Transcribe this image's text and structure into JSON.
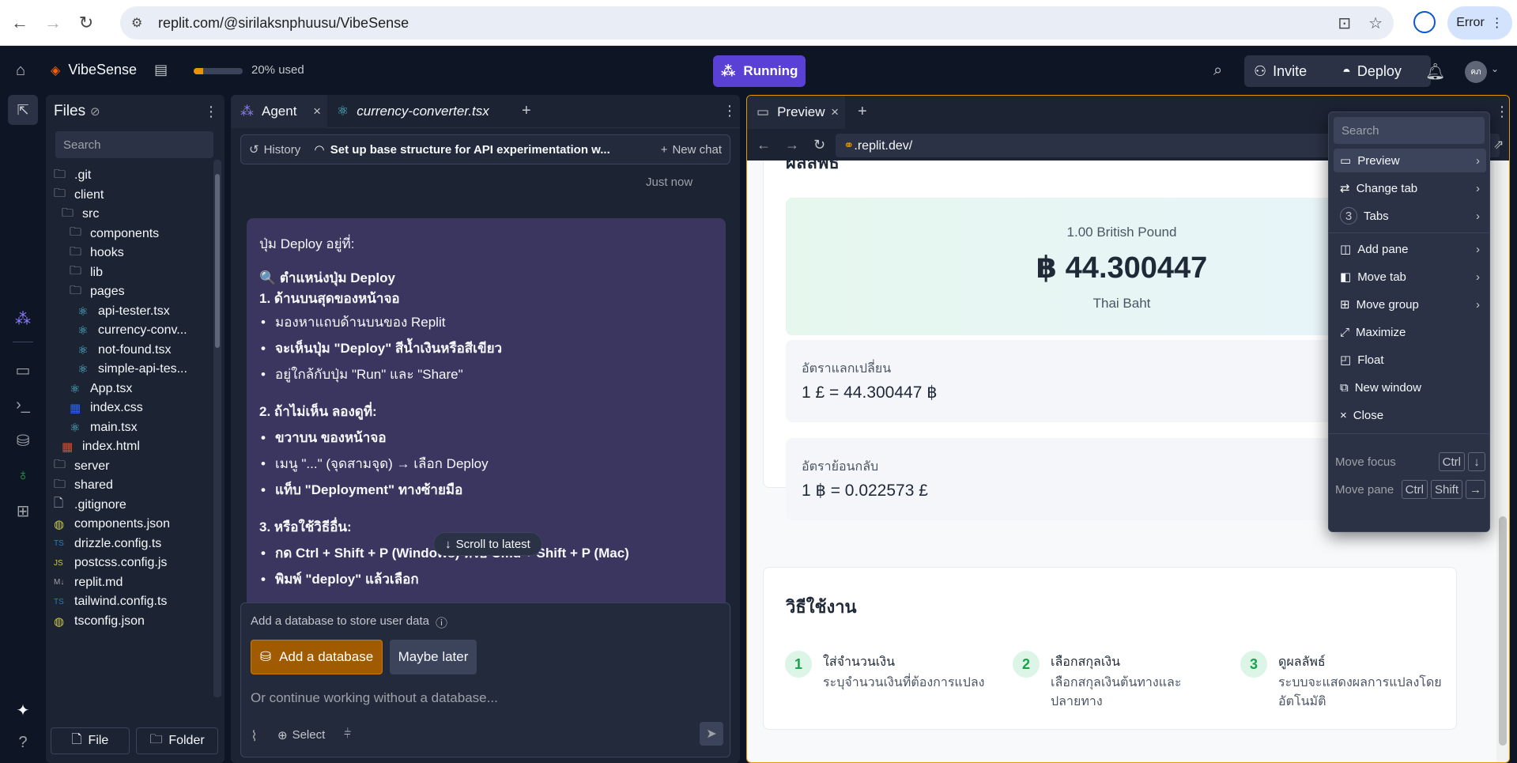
{
  "browser": {
    "url": "replit.com/@sirilaksnphuusu/VibeSense",
    "profile_button": "Error"
  },
  "header": {
    "repl_name": "VibeSense",
    "usage_fraction": 0.2,
    "usage_text": "20% used",
    "run_status": "Running",
    "invite_label": "Invite",
    "deploy_label": "Deploy",
    "avatar_text": "คภ"
  },
  "files": {
    "title": "Files",
    "search_placeholder": "Search",
    "tree": [
      {
        "name": ".git",
        "type": "folder",
        "depth": 0
      },
      {
        "name": "client",
        "type": "folder",
        "depth": 0
      },
      {
        "name": "src",
        "type": "folder",
        "depth": 1
      },
      {
        "name": "components",
        "type": "folder",
        "depth": 2
      },
      {
        "name": "hooks",
        "type": "folder",
        "depth": 2
      },
      {
        "name": "lib",
        "type": "folder",
        "depth": 2
      },
      {
        "name": "pages",
        "type": "folder",
        "depth": 2
      },
      {
        "name": "api-tester.tsx",
        "type": "react",
        "depth": 3
      },
      {
        "name": "currency-conv...",
        "type": "react",
        "depth": 3
      },
      {
        "name": "not-found.tsx",
        "type": "react",
        "depth": 3
      },
      {
        "name": "simple-api-tes...",
        "type": "react",
        "depth": 3
      },
      {
        "name": "App.tsx",
        "type": "react",
        "depth": 2
      },
      {
        "name": "index.css",
        "type": "css",
        "depth": 2
      },
      {
        "name": "main.tsx",
        "type": "react",
        "depth": 2
      },
      {
        "name": "index.html",
        "type": "html",
        "depth": 1
      },
      {
        "name": "server",
        "type": "folder",
        "depth": 0
      },
      {
        "name": "shared",
        "type": "folder",
        "depth": 0
      },
      {
        "name": ".gitignore",
        "type": "file",
        "depth": 0
      },
      {
        "name": "components.json",
        "type": "json",
        "depth": 0
      },
      {
        "name": "drizzle.config.ts",
        "type": "ts",
        "depth": 0
      },
      {
        "name": "postcss.config.js",
        "type": "js",
        "depth": 0
      },
      {
        "name": "replit.md",
        "type": "md",
        "depth": 0
      },
      {
        "name": "tailwind.config.ts",
        "type": "ts",
        "depth": 0
      },
      {
        "name": "tsconfig.json",
        "type": "json",
        "depth": 0
      }
    ],
    "file_button": "File",
    "folder_button": "Folder"
  },
  "agent": {
    "tab_agent": "Agent",
    "tab_file": "currency-converter.tsx",
    "history_label": "History",
    "chat_title": "Set up base structure for API experimentation w...",
    "new_chat_label": "New chat",
    "timestamp": "Just now",
    "message": {
      "intro": "ปุ่ม Deploy อยู่ที่:",
      "section_title": "🔍 ตำแหน่งปุ่ม Deploy",
      "h1": "1. ด้านบนสุดของหน้าจอ",
      "list1": [
        "มองหาแถบด้านบนของ Replit",
        "จะเห็นปุ่ม \"Deploy\" สีน้ำเงินหรือสีเขียว",
        "อยู่ใกล้กับปุ่ม \"Run\" และ \"Share\""
      ],
      "h2": "2. ถ้าไม่เห็น ลองดูที่:",
      "list2": [
        "ขวาบน ของหน้าจอ",
        "เมนู \"...\" (จุดสามจุด) → เลือก Deploy",
        "แท็บ \"Deployment\" ทางซ้ายมือ"
      ],
      "h3": "3. หรือใช้วิธีอื่น:",
      "list3": [
        "กด Ctrl + Shift + P (Windows) หรือ Cmd + Shift + P (Mac)",
        "พิมพ์ \"deploy\" แล้วเลือก"
      ]
    },
    "scroll_latest": "Scroll to latest",
    "db_prompt": "Add a database to store user data",
    "add_db_button": "Add a database",
    "maybe_later_button": "Maybe later",
    "input_placeholder": "Or continue working without a database...",
    "select_label": "Select"
  },
  "preview": {
    "tab_label": "Preview",
    "address": ".replit.dev/",
    "page": {
      "result_heading": "ผลลัพธ์",
      "from_amount": "1.00 British Pound",
      "result_value": "฿ 44.300447",
      "result_currency": "Thai Baht",
      "rate_label": "อัตราแลกเปลี่ยน",
      "rate_value": "1 £ = 44.300447 ฿",
      "inverse_label": "อัตราย้อนกลับ",
      "inverse_value": "1 ฿ = 0.022573 £",
      "howto_title": "วิธีใช้งาน",
      "steps": [
        {
          "n": "1",
          "title": "ใส่จำนวนเงิน",
          "desc": "ระบุจำนวนเงินที่ต้องการแปลง"
        },
        {
          "n": "2",
          "title": "เลือกสกุลเงิน",
          "desc": "เลือกสกุลเงินต้นทางและปลายทาง"
        },
        {
          "n": "3",
          "title": "ดูผลลัพธ์",
          "desc": "ระบบจะแสดงผลการแปลงโดยอัตโนมัติ"
        }
      ]
    }
  },
  "menu": {
    "search_placeholder": "Search",
    "items": [
      "Preview",
      "Change tab",
      "Tabs",
      "Add pane",
      "Move tab",
      "Move group",
      "Maximize",
      "Float",
      "New window",
      "Close"
    ],
    "tabs_count": "3",
    "move_focus": "Move focus",
    "move_pane": "Move pane",
    "key_ctrl": "Ctrl",
    "key_shift": "Shift"
  }
}
